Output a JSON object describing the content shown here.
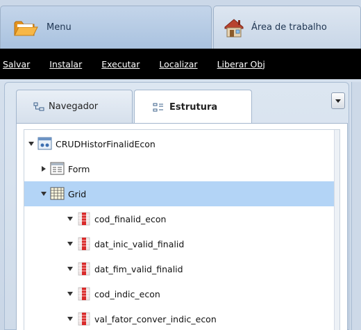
{
  "tabs": {
    "menu_label": "Menu",
    "area_label": "Área de trabalho"
  },
  "toolbar": {
    "items": [
      "Salvar",
      "Instalar",
      "Executar",
      "Localizar",
      "Liberar Obj"
    ]
  },
  "panel": {
    "tab_nav_label": "Navegador",
    "tab_estrutura_label": "Estrutura",
    "active_tab": "Estrutura"
  },
  "tree": {
    "root": "CRUDHistorFinalidEcon",
    "form": "Form",
    "grid": "Grid",
    "fields": [
      "cod_finalid_econ",
      "dat_inic_valid_finalid",
      "dat_fim_valid_finalid",
      "cod_indic_econ",
      "val_fator_conver_indic_econ"
    ]
  },
  "colors": {
    "selected_row": "#b3d4f6",
    "command_bar": "#000000",
    "accent": "#a9c2df"
  }
}
